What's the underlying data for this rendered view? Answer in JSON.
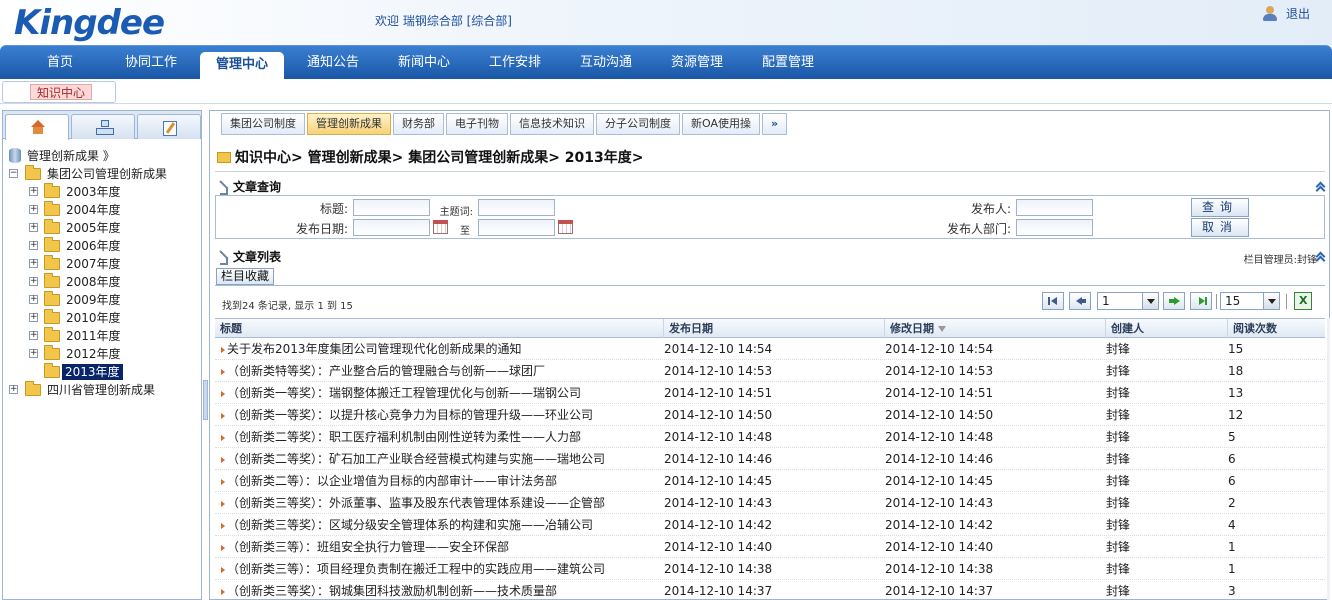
{
  "header": {
    "logo": "Kingdee",
    "welcome": "欢迎  瑞钢综合部 [综合部]",
    "logout": "退出"
  },
  "nav": {
    "items": [
      "首页",
      "协同工作",
      "管理中心",
      "通知公告",
      "新闻中心",
      "工作安排",
      "互动沟通",
      "资源管理",
      "配置管理"
    ],
    "active": "管理中心"
  },
  "subnav": {
    "tab": "知识中心"
  },
  "left_tabs": [
    "home-icon",
    "tree-icon",
    "edit-icon"
  ],
  "tree": {
    "root": "管理创新成果 》",
    "group1": "集团公司管理创新成果",
    "years": [
      "2003年度",
      "2004年度",
      "2005年度",
      "2006年度",
      "2007年度",
      "2008年度",
      "2009年度",
      "2010年度",
      "2011年度",
      "2012年度",
      "2013年度"
    ],
    "selected": "2013年度",
    "group2": "四川省管理创新成果"
  },
  "category_tabs": [
    "集团公司制度",
    "管理创新成果",
    "财务部",
    "电子刊物",
    "信息技术知识",
    "分子公司制度",
    "新OA使用操",
    "»"
  ],
  "category_active": "管理创新成果",
  "breadcrumb": "知识中心> 管理创新成果> 集团公司管理创新成果> 2013年度>",
  "query": {
    "section_title": "文章查询",
    "title_label": "标题:",
    "keyword_label": "主题词:",
    "date_label": "发布日期:",
    "to_label": "至",
    "publisher_label": "发布人:",
    "dept_label": "发布人部门:",
    "search_button": "查询",
    "cancel_button": "取消"
  },
  "list": {
    "section_title": "文章列表",
    "admin": "栏目管理员:封锋",
    "favorite_button": "栏目收藏",
    "records": "找到24 条记录, 显示 1 到 15",
    "page": "1",
    "page_size": "15",
    "headers": {
      "title": "标题",
      "pub": "发布日期",
      "mod": "修改日期",
      "creator": "创建人",
      "reads": "阅读次数"
    },
    "rows": [
      {
        "title": "关于发布2013年度集团公司管理现代化创新成果的通知",
        "pub": "2014-12-10 14:54",
        "mod": "2014-12-10 14:54",
        "creator": "封锋",
        "reads": "15"
      },
      {
        "title": "（创新类特等奖）：产业整合后的管理融合与创新——球团厂",
        "pub": "2014-12-10 14:53",
        "mod": "2014-12-10 14:53",
        "creator": "封锋",
        "reads": "18"
      },
      {
        "title": "（创新类一等奖）：瑞钢整体搬迁工程管理优化与创新——瑞钢公司",
        "pub": "2014-12-10 14:51",
        "mod": "2014-12-10 14:51",
        "creator": "封锋",
        "reads": "13"
      },
      {
        "title": "（创新类一等奖）：以提升核心竞争力为目标的管理升级——环业公司",
        "pub": "2014-12-10 14:50",
        "mod": "2014-12-10 14:50",
        "creator": "封锋",
        "reads": "12"
      },
      {
        "title": "（创新类二等奖）：职工医疗福利机制由刚性逆转为柔性——人力部",
        "pub": "2014-12-10 14:48",
        "mod": "2014-12-10 14:48",
        "creator": "封锋",
        "reads": "5"
      },
      {
        "title": "（创新类二等奖）：矿石加工产业联合经营模式构建与实施——瑞地公司",
        "pub": "2014-12-10 14:46",
        "mod": "2014-12-10 14:46",
        "creator": "封锋",
        "reads": "6"
      },
      {
        "title": "（创新类二等）：以企业增值为目标的内部审计——审计法务部",
        "pub": "2014-12-10 14:45",
        "mod": "2014-12-10 14:45",
        "creator": "封锋",
        "reads": "6"
      },
      {
        "title": "（创新类三等奖）：外派董事、监事及股东代表管理体系建设——企管部",
        "pub": "2014-12-10 14:43",
        "mod": "2014-12-10 14:43",
        "creator": "封锋",
        "reads": "2"
      },
      {
        "title": "（创新类三等奖）：区域分级安全管理体系的构建和实施——冶辅公司",
        "pub": "2014-12-10 14:42",
        "mod": "2014-12-10 14:42",
        "creator": "封锋",
        "reads": "4"
      },
      {
        "title": "（创新类三等）：班组安全执行力管理——安全环保部",
        "pub": "2014-12-10 14:40",
        "mod": "2014-12-10 14:40",
        "creator": "封锋",
        "reads": "1"
      },
      {
        "title": "（创新类三等）：项目经理负责制在搬迁工程中的实践应用——建筑公司",
        "pub": "2014-12-10 14:38",
        "mod": "2014-12-10 14:38",
        "creator": "封锋",
        "reads": "1"
      },
      {
        "title": "（创新类三等奖）：钢城集团科技激励机制创新——技术质量部",
        "pub": "2014-12-10 14:37",
        "mod": "2014-12-10 14:37",
        "creator": "封锋",
        "reads": "3"
      }
    ]
  }
}
